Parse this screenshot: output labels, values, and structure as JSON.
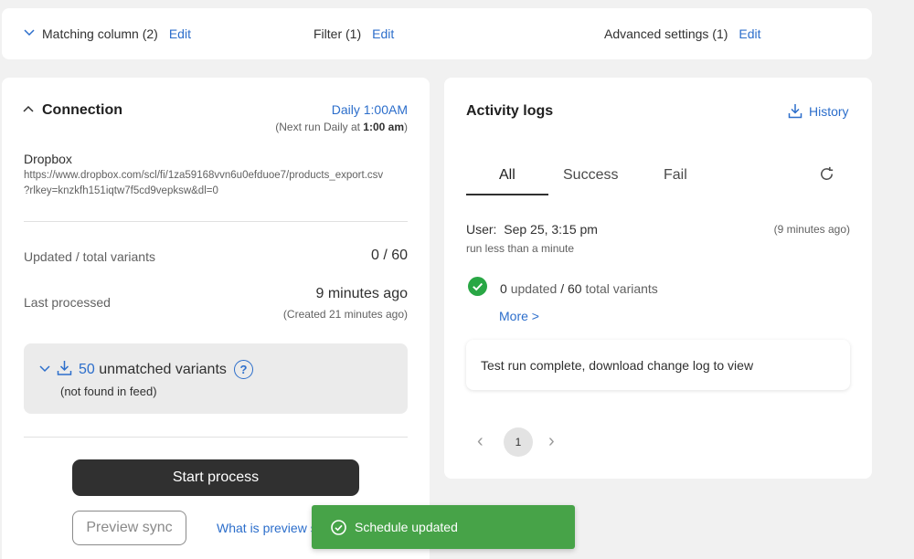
{
  "topbar": {
    "matching": {
      "label": "Matching column (2)",
      "edit": "Edit"
    },
    "filter": {
      "label": "Filter (1)",
      "edit": "Edit"
    },
    "advanced": {
      "label": "Advanced settings (1)",
      "edit": "Edit"
    }
  },
  "connection": {
    "title": "Connection",
    "schedule": "Daily 1:00AM",
    "next_run_prefix": "(Next run Daily at ",
    "next_run_time": "1:00 am",
    "next_run_suffix": ")",
    "source_name": "Dropbox",
    "source_url_line1": "https://www.dropbox.com/scl/fi/1za59168vvn6u0efduoe7/products_export.csv",
    "source_url_line2": "?rlkey=knzkfh151iqtw7f5cd9vepksw&dl=0",
    "updated_label": "Updated / total variants",
    "updated_value": "0 / 60",
    "last_processed_label": "Last processed",
    "last_processed_value": "9 minutes ago",
    "created_value": "(Created 21 minutes ago)",
    "unmatched_count": "50",
    "unmatched_label": "unmatched variants",
    "unmatched_note": "(not found in feed)",
    "help_icon_text": "?",
    "start_button": "Start process",
    "preview_button": "Preview sync",
    "preview_link": "What is preview s"
  },
  "activity": {
    "title": "Activity logs",
    "history_link": "History",
    "tabs": [
      {
        "label": "All",
        "active": true
      },
      {
        "label": "Success",
        "active": false
      },
      {
        "label": "Fail",
        "active": false
      }
    ],
    "log": {
      "user_label": "User:",
      "datetime": "Sep 25, 3:15 pm",
      "ago": "(9 minutes ago)",
      "duration": "run less than a minute",
      "updated_count": "0",
      "updated_word": "updated",
      "slash": "/",
      "total_count": "60",
      "total_word": "total variants",
      "more_link": "More >"
    },
    "message": "Test run complete, download change log to view",
    "pagination": {
      "prev": "‹",
      "current": "1",
      "next": "›"
    }
  },
  "toast": {
    "text": "Schedule updated"
  },
  "colors": {
    "accent": "#2c6ecb",
    "success": "#29a745",
    "toast_bg": "#47a348",
    "dark_button": "#303030",
    "page_bg": "#f1f1f1"
  }
}
